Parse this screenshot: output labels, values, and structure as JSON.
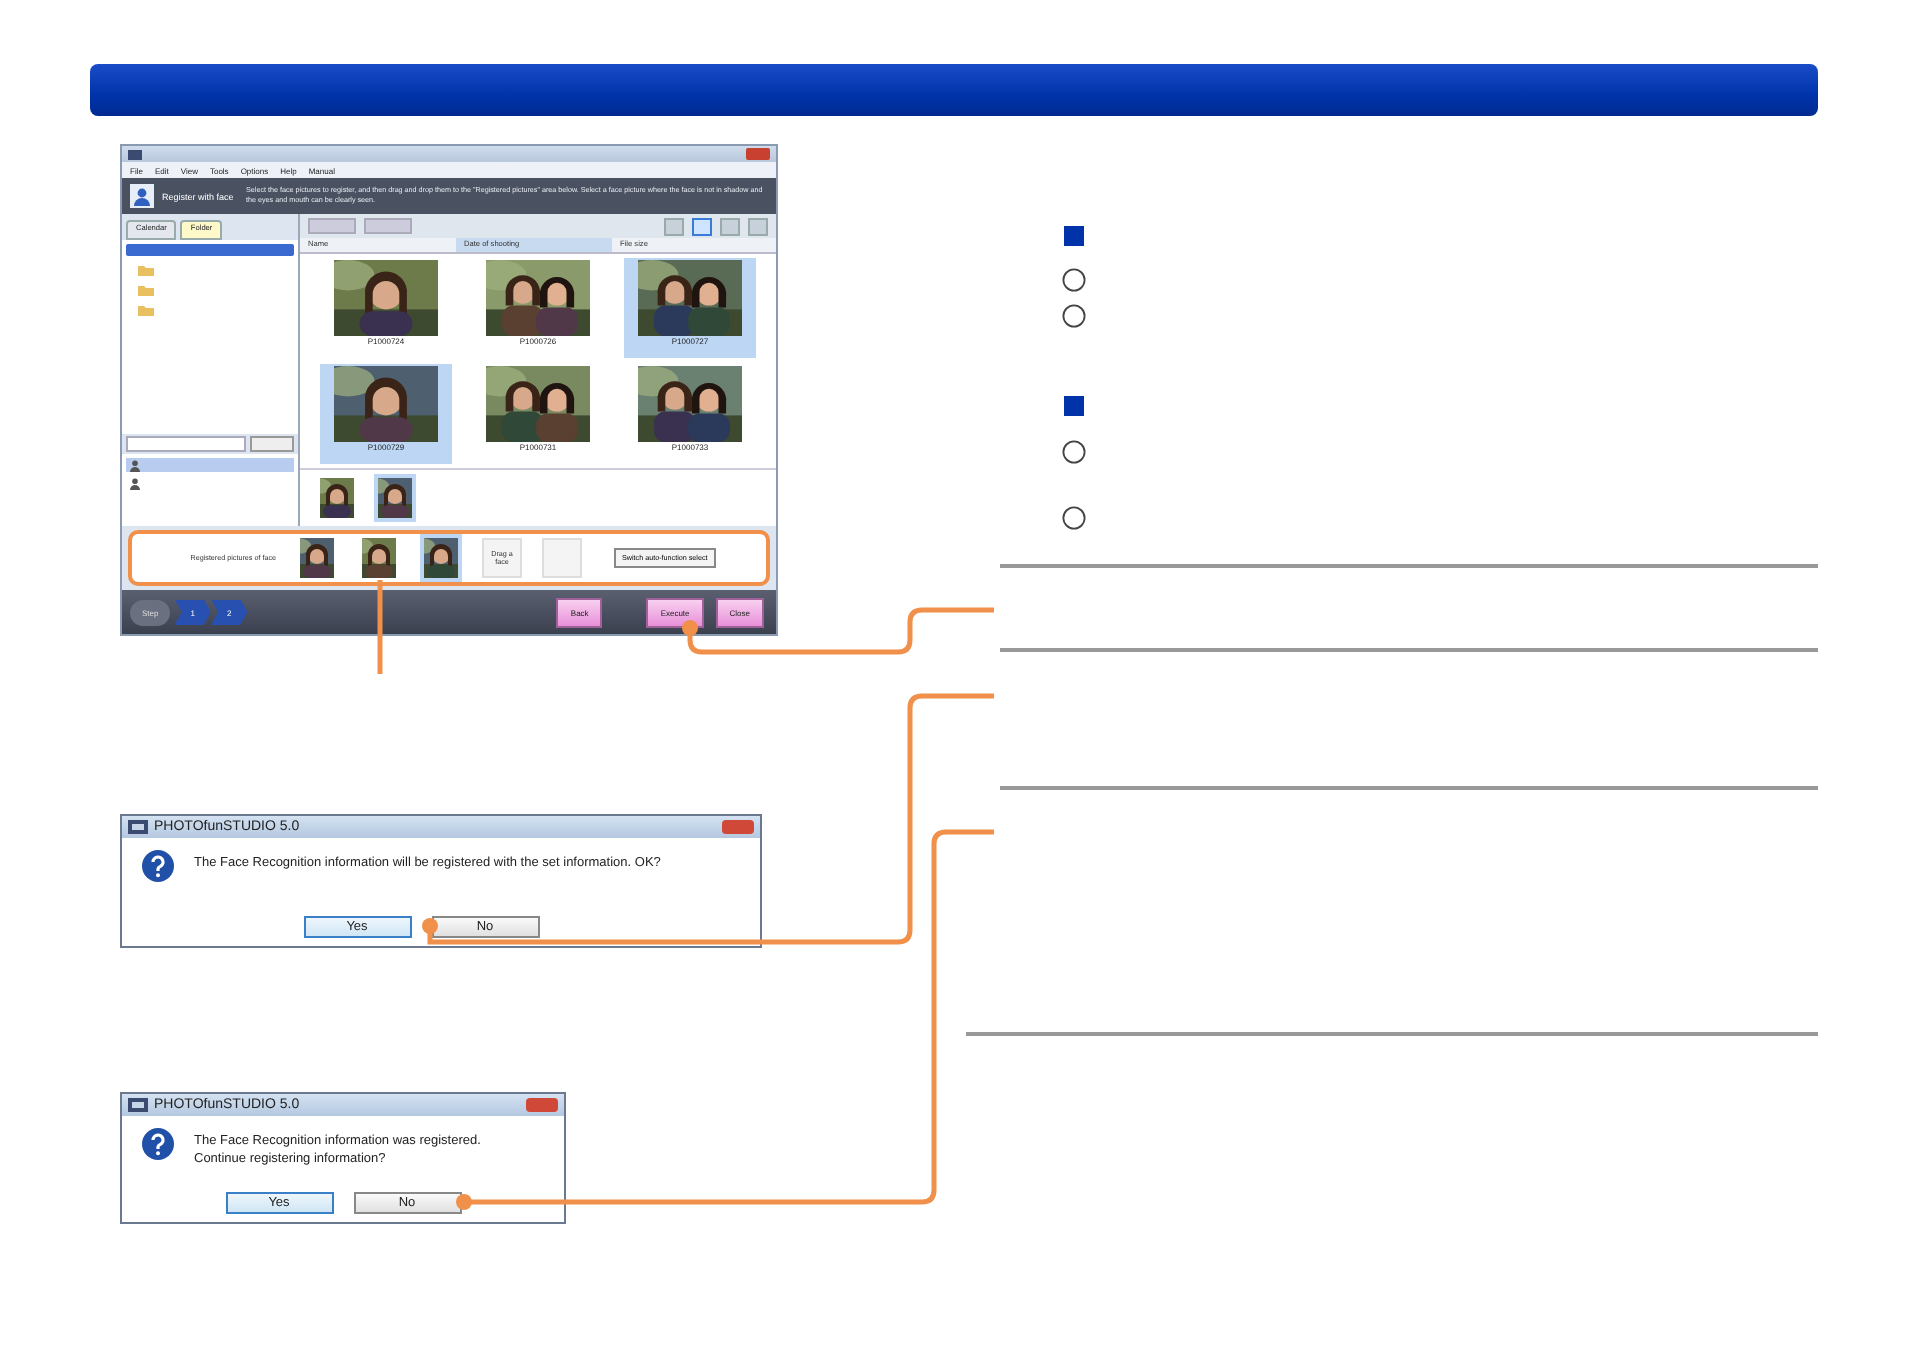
{
  "app_window": {
    "menu": [
      "File",
      "Edit",
      "View",
      "Tools",
      "Options",
      "Help",
      "Manual"
    ],
    "banner": {
      "title": "Register with face",
      "instruction": "Select the face pictures to register, and then drag and drop them to the \"Registered pictures\" area below. Select a face picture where the face is not in shadow and the eyes and mouth can be clearly seen."
    },
    "left_tabs": [
      {
        "label": "Calendar",
        "selected": false
      },
      {
        "label": "Folder",
        "selected": true
      }
    ],
    "columns": [
      "Name",
      "Date of shooting",
      "File size"
    ],
    "photos": [
      {
        "label": "P1000724",
        "selected": false
      },
      {
        "label": "P1000726",
        "selected": false
      },
      {
        "label": "P1000727",
        "selected": true
      },
      {
        "label": "P1000729",
        "selected": true
      },
      {
        "label": "P1000731",
        "selected": false
      },
      {
        "label": "P1000733",
        "selected": false
      }
    ],
    "strip": [
      {
        "selected": false
      },
      {
        "selected": true
      }
    ],
    "registered": {
      "label": "Registered pictures of face",
      "slots": [
        {
          "selected": false
        },
        {
          "selected": false
        },
        {
          "selected": true
        }
      ],
      "drop_hint": "Drag a face",
      "switch_button": "Switch auto-function select"
    },
    "nav": {
      "step_label": "Step",
      "steps": [
        "1",
        "2"
      ],
      "buttons": [
        "Back",
        "Execute",
        "Close"
      ]
    }
  },
  "dialogs": [
    {
      "title": "PHOTOfunSTUDIO 5.0",
      "message": "The Face Recognition information will be registered with the set information. OK?",
      "buttons": [
        {
          "label": "Yes",
          "focused": true
        },
        {
          "label": "No",
          "focused": false
        }
      ]
    },
    {
      "title": "PHOTOfunSTUDIO 5.0",
      "message": "The Face Recognition information was registered.\nContinue registering information?",
      "buttons": [
        {
          "label": "Yes",
          "focused": true
        },
        {
          "label": "No",
          "focused": false
        }
      ]
    }
  ]
}
